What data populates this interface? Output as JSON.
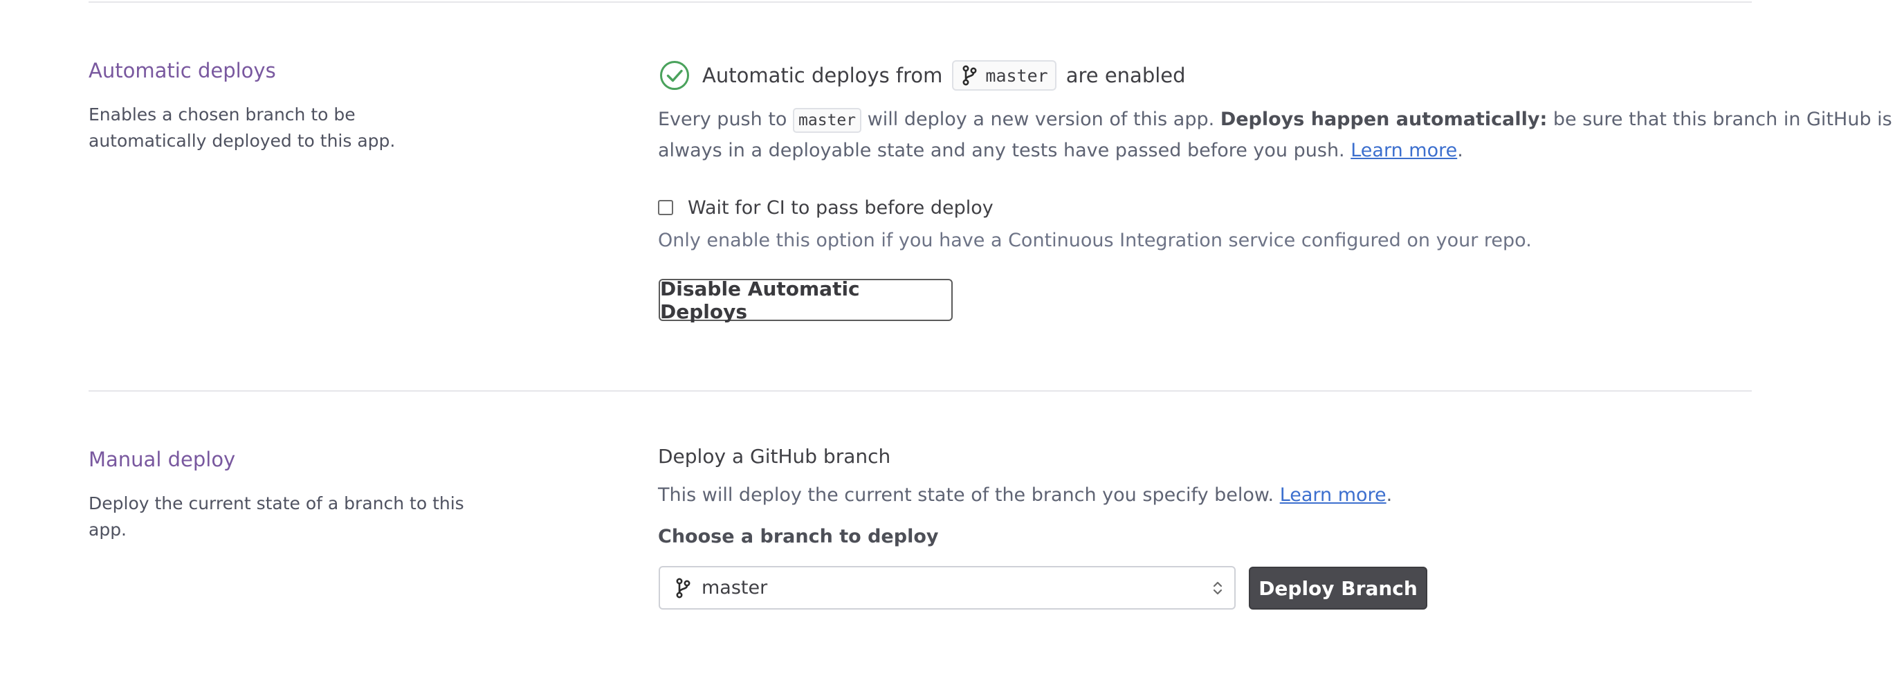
{
  "auto_deploys": {
    "title": "Automatic deploys",
    "description": "Enables a chosen branch to be automatically deployed to this app.",
    "status_prefix": "Automatic deploys from",
    "status_branch": "master",
    "status_suffix": "are enabled",
    "para_prefix": "Every push to",
    "para_branch": "master",
    "para_mid": "will deploy a new version of this app.",
    "para_bold": "Deploys happen automatically:",
    "para_rest_1": "be sure that this branch in GitHub is",
    "para_rest_2": "always in a deployable state and any tests have passed before you push.",
    "learn_more": "Learn more",
    "wait_ci_label": "Wait for CI to pass before deploy",
    "wait_ci_checked": false,
    "wait_ci_hint": "Only enable this option if you have a Continuous Integration service configured on your repo.",
    "disable_button": "Disable Automatic Deploys"
  },
  "manual_deploy": {
    "title": "Manual deploy",
    "description": "Deploy the current state of a branch to this app.",
    "heading": "Deploy a GitHub branch",
    "para": "This will deploy the current state of the branch you specify below.",
    "learn_more": "Learn more",
    "choose_label": "Choose a branch to deploy",
    "selected_branch": "master",
    "deploy_button": "Deploy Branch"
  },
  "icons": {
    "status": "check-circle-icon",
    "branch": "git-branch-icon",
    "select": "chevron-up-down-icon"
  },
  "colors": {
    "section_title": "#79589f",
    "success": "#4aa25c",
    "link": "#3c6fce",
    "dark_button": "#4a4a4f"
  }
}
